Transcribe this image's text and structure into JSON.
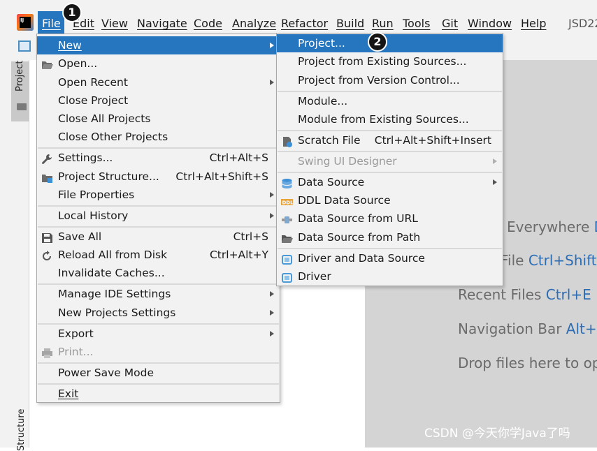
{
  "menubar": {
    "logo_text": "IJ",
    "items": [
      "File",
      "Edit",
      "View",
      "Navigate",
      "Code",
      "Analyze",
      "Refactor",
      "Build",
      "Run",
      "Tools",
      "Git",
      "Window",
      "Help"
    ],
    "project_title": "JSD22"
  },
  "badges": {
    "one": "1",
    "two": "2"
  },
  "left_strip": {
    "project_tab": "Project",
    "structure_tab": "Structure"
  },
  "file_menu": {
    "new": "New",
    "open": "Open...",
    "open_recent": "Open Recent",
    "close_project": "Close Project",
    "close_all": "Close All Projects",
    "close_other": "Close Other Projects",
    "settings": "Settings...",
    "settings_sc": "Ctrl+Alt+S",
    "project_structure": "Project Structure...",
    "project_structure_sc": "Ctrl+Alt+Shift+S",
    "file_properties": "File Properties",
    "local_history": "Local History",
    "save_all": "Save All",
    "save_all_sc": "Ctrl+S",
    "reload": "Reload All from Disk",
    "reload_sc": "Ctrl+Alt+Y",
    "invalidate": "Invalidate Caches...",
    "manage_ide": "Manage IDE Settings",
    "new_projects": "New Projects Settings",
    "export": "Export",
    "print": "Print...",
    "power_save": "Power Save Mode",
    "exit": "Exit"
  },
  "new_menu": {
    "project": "Project...",
    "from_existing": "Project from Existing Sources...",
    "from_vcs": "Project from Version Control...",
    "module": "Module...",
    "module_existing": "Module from Existing Sources...",
    "scratch": "Scratch File",
    "scratch_sc": "Ctrl+Alt+Shift+Insert",
    "swing": "Swing UI Designer",
    "data_source": "Data Source",
    "ddl": "DDL Data Source",
    "ds_url": "Data Source from URL",
    "ds_path": "Data Source from Path",
    "driver_ds": "Driver and Data Source",
    "driver": "Driver"
  },
  "editor_hints": {
    "everywhere": "Everywhere",
    "everywhere_key": "D",
    "file": "File",
    "file_key": "Ctrl+Shift+",
    "recent": "Recent Files",
    "recent_key": "Ctrl+E",
    "navbar": "Navigation Bar",
    "navbar_key": "Alt+H",
    "drop": "Drop files here to op"
  },
  "watermark": "CSDN @今天你学Java了吗",
  "colors": {
    "accent": "#2675bf",
    "menu_bg": "#f2f2f2",
    "hint_key": "#2c6db5"
  }
}
